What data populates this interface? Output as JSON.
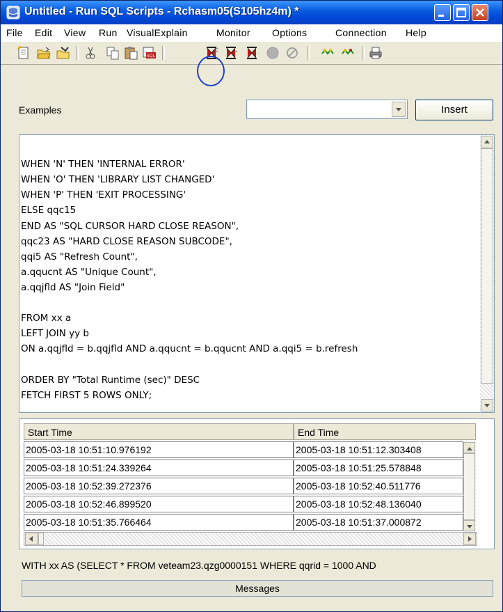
{
  "window": {
    "title": "Untitled - Run SQL Scripts - Rchasm05(S105hz4m) *"
  },
  "menu": [
    "File",
    "Edit",
    "View",
    "Run",
    "VisualExplain",
    "Monitor",
    "Options",
    "Connection",
    "Help"
  ],
  "toolbar": {
    "icons": [
      "new-icon",
      "open-icon",
      "save-icon",
      "cut-icon",
      "copy-icon",
      "paste-icon",
      "insert-sql-icon",
      "run-all-icon",
      "run-from-selected-icon",
      "run-selected-icon",
      "stop-icon",
      "cancel-icon",
      "explain-icon",
      "run-and-explain-icon",
      "print-icon"
    ]
  },
  "examples": {
    "label": "Examples",
    "selected": "",
    "insert_label": "Insert"
  },
  "editor": {
    "lines": [
      "WHEN 'N' THEN 'INTERNAL ERROR'",
      "WHEN 'O' THEN 'LIBRARY LIST CHANGED'",
      "WHEN 'P' THEN 'EXIT PROCESSING'",
      "ELSE qqc15",
      "END AS \"SQL CURSOR HARD CLOSE REASON\",",
      "qqc23 AS \"HARD CLOSE REASON SUBCODE\",",
      "qqi5 AS \"Refresh Count\",",
      "a.qqucnt AS \"Unique Count\",",
      "a.qqjfld AS \"Join Field\"",
      "",
      "FROM xx a",
      "LEFT JOIN yy b",
      "ON a.qqjfld = b.qqjfld AND a.qqucnt = b.qqucnt AND a.qqi5 = b.refresh",
      "",
      "ORDER BY \"Total Runtime (sec)\" DESC",
      "FETCH FIRST 5 ROWS ONLY;"
    ]
  },
  "results": {
    "columns": [
      "Start Time",
      "End Time"
    ],
    "rows": [
      [
        "2005-03-18 10:51:10.976192",
        "2005-03-18 10:51:12.303408"
      ],
      [
        "2005-03-18 10:51:24.339264",
        "2005-03-18 10:51:25.578848"
      ],
      [
        "2005-03-18 10:52:39.272376",
        "2005-03-18 10:52:40.511776"
      ],
      [
        "2005-03-18 10:52:46.899520",
        "2005-03-18 10:52:48.136040"
      ],
      [
        "2005-03-18 10:51:35.766464",
        "2005-03-18 10:51:37.000872"
      ]
    ]
  },
  "status": {
    "statement": "WITH xx AS  (SELECT * FROM veteam23.qzg0000151 WHERE qqrid = 1000 AND"
  },
  "messages_tab": "Messages",
  "colors": {
    "title_bar": "#0a5fe0",
    "highlight_ring": "#1f3fc8",
    "window_bg": "#ece9d8"
  }
}
